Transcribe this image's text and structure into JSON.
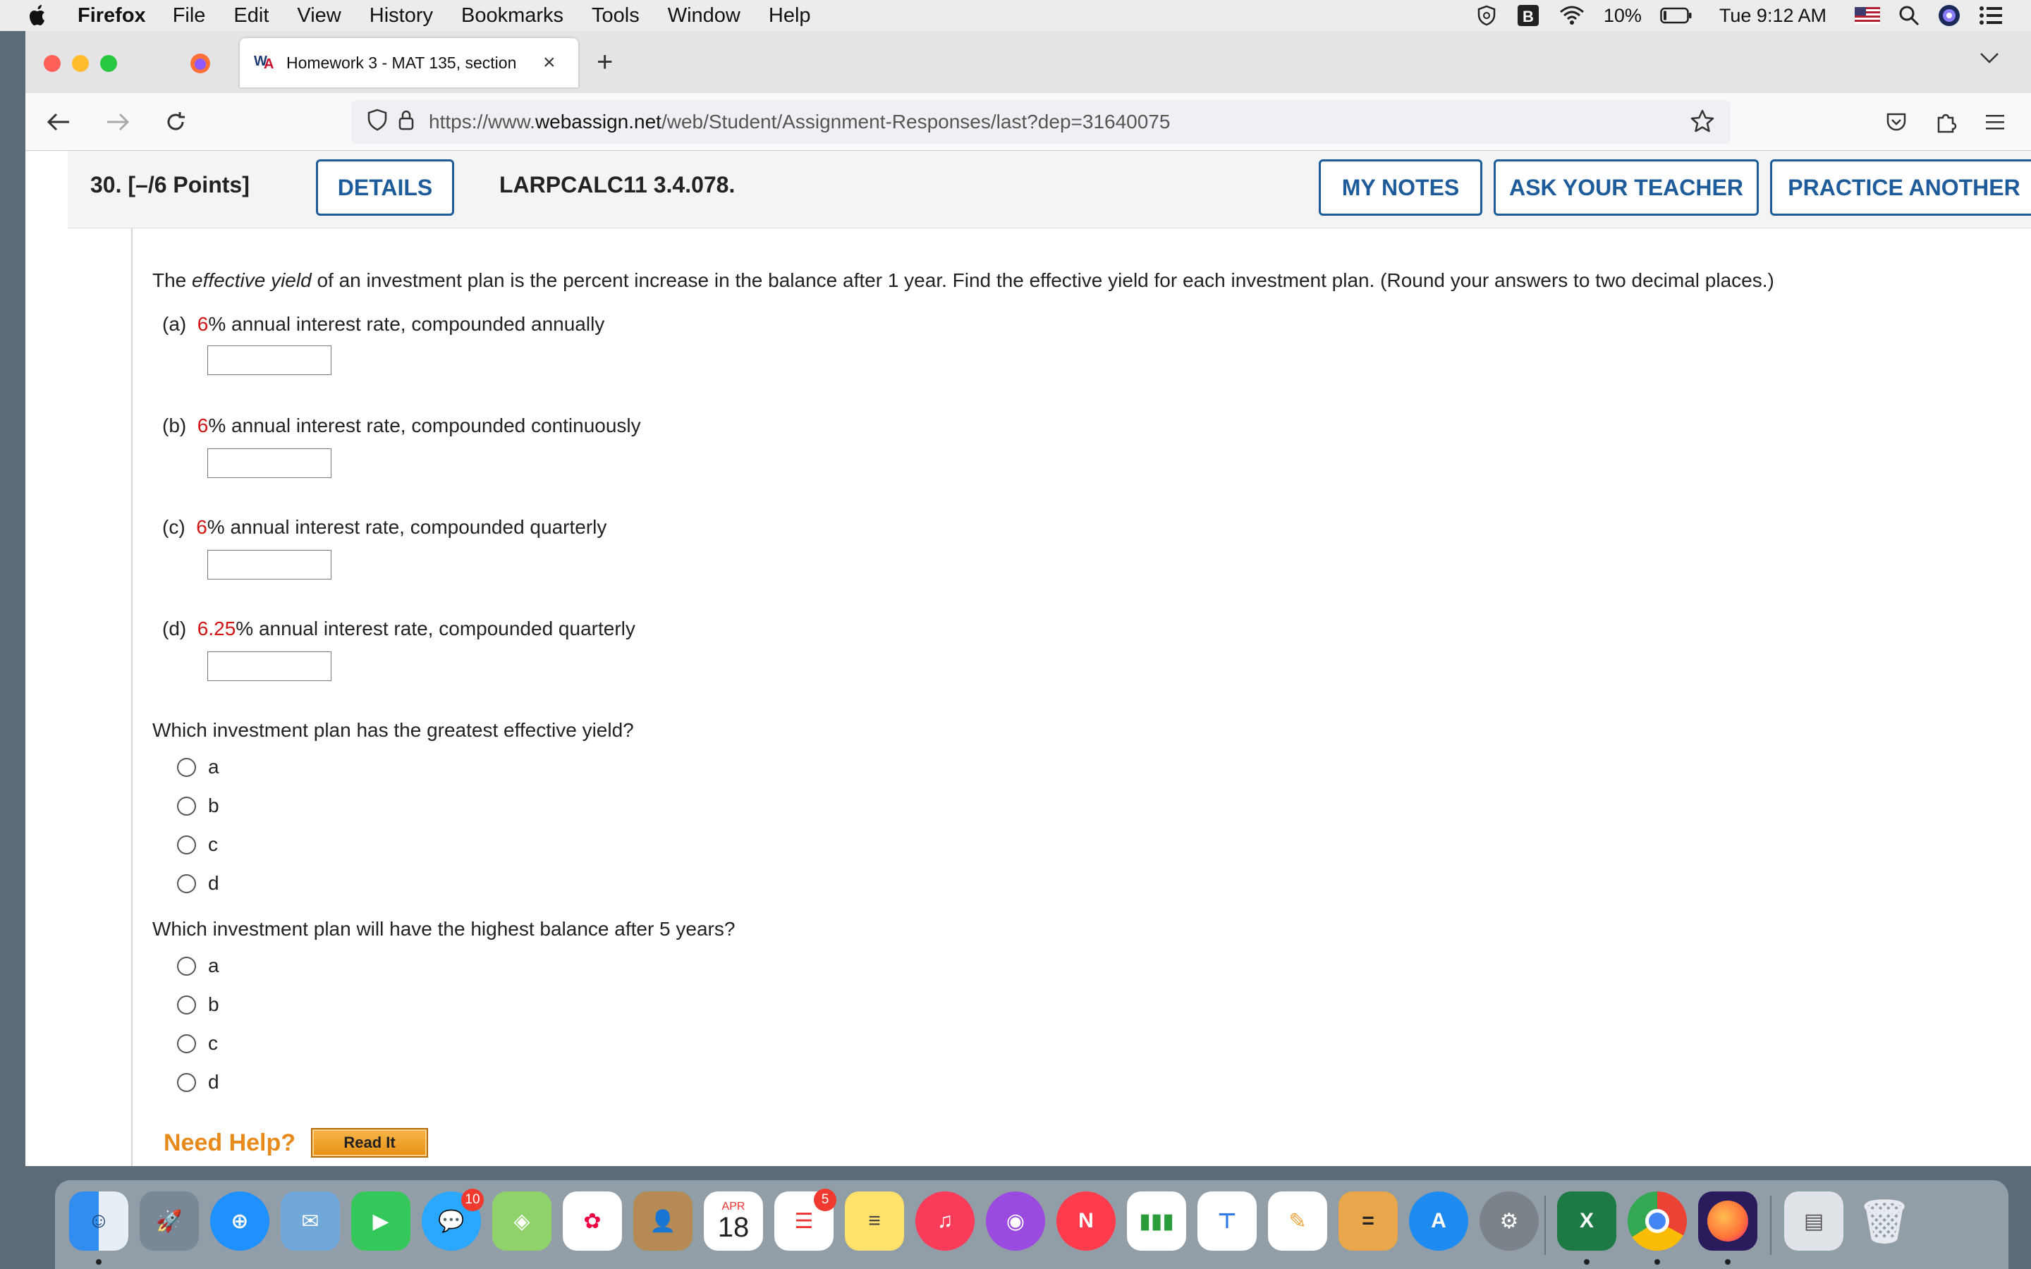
{
  "menubar": {
    "app": "Firefox",
    "items": [
      "File",
      "Edit",
      "View",
      "History",
      "Bookmarks",
      "Tools",
      "Window",
      "Help"
    ],
    "battery": "10%",
    "clock": "Tue 9:12 AM"
  },
  "browser": {
    "tab_title": "Homework 3 - MAT 135, section",
    "url_prefix": "https://www.",
    "url_host": "webassign.net",
    "url_path": "/web/Student/Assignment-Responses/last?dep=31640075"
  },
  "question": {
    "number": "30.  [–/6 Points]",
    "details_label": "DETAILS",
    "code": "LARPCALC11 3.4.078.",
    "my_notes_label": "MY NOTES",
    "ask_teacher_label": "ASK YOUR TEACHER",
    "practice_label": "PRACTICE ANOTHER",
    "intro_before": "The ",
    "intro_em": "effective yield",
    "intro_after": " of an investment plan is the percent increase in the balance after 1 year. Find the effective yield for each investment plan. (Round your answers to two decimal places.)",
    "parts": [
      {
        "label": "(a)",
        "rate": "6",
        "text": "% annual interest rate, compounded annually"
      },
      {
        "label": "(b)",
        "rate": "6",
        "text": "% annual interest rate, compounded continuously"
      },
      {
        "label": "(c)",
        "rate": "6",
        "text": "% annual interest rate, compounded quarterly"
      },
      {
        "label": "(d)",
        "rate": "6.25",
        "text": "% annual interest rate, compounded quarterly"
      }
    ],
    "q1": "Which investment plan has the greatest effective yield?",
    "q2": "Which investment plan will have the highest balance after 5 years?",
    "options": [
      "a",
      "b",
      "c",
      "d"
    ],
    "need_help": "Need Help?",
    "read_it": "Read It"
  },
  "dock": {
    "mail_badge": "10",
    "calendar_month": "APR",
    "calendar_day": "18",
    "reminders_badge": "5"
  },
  "colors": {
    "webassign_blue": "#1e5b9b",
    "value_red": "#d21414",
    "help_orange": "#e8891c"
  }
}
